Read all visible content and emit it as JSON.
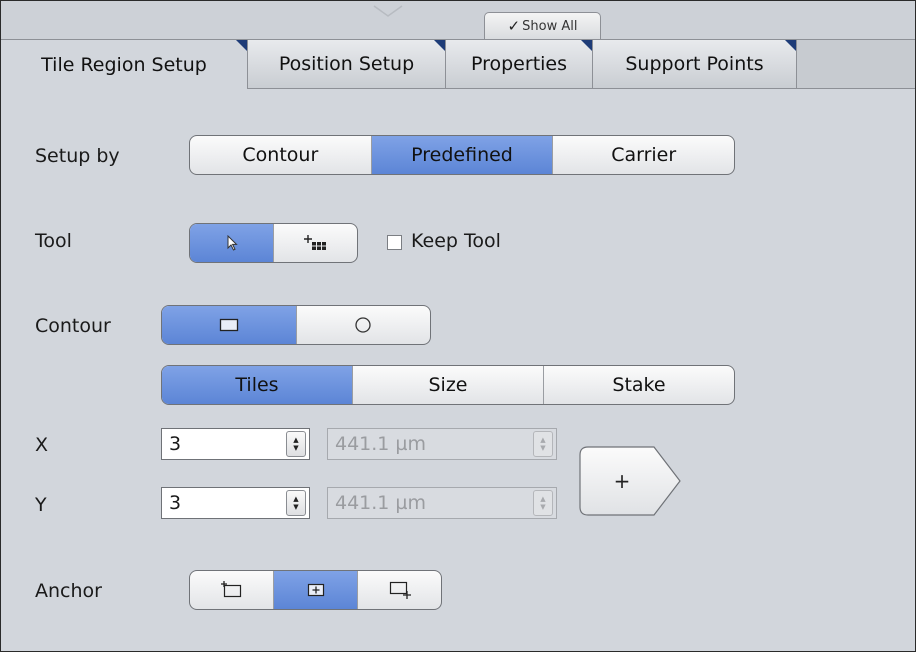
{
  "toolbar": {
    "show_all_check": "✓",
    "show_all_label": "Show All"
  },
  "tabs": [
    {
      "label": "Tile Region Setup",
      "active": true
    },
    {
      "label": "Position Setup",
      "active": false
    },
    {
      "label": "Properties",
      "active": false
    },
    {
      "label": "Support Points",
      "active": false
    }
  ],
  "setup_by": {
    "label": "Setup by",
    "options": [
      "Contour",
      "Predefined",
      "Carrier"
    ],
    "selected": "Predefined"
  },
  "tool": {
    "label": "Tool",
    "options": [
      "pointer-icon",
      "add-tiles-icon"
    ],
    "selected": "pointer-icon",
    "keep_tool_label": "Keep Tool",
    "keep_tool_checked": false
  },
  "contour": {
    "label": "Contour",
    "shapes": [
      "rectangle-icon",
      "circle-icon"
    ],
    "selected_shape": "rectangle-icon",
    "modes": [
      "Tiles",
      "Size",
      "Stake"
    ],
    "selected_mode": "Tiles"
  },
  "x": {
    "label": "X",
    "tiles": "3",
    "size": "441.1 µm"
  },
  "y": {
    "label": "Y",
    "tiles": "3",
    "size": "441.1 µm"
  },
  "add_button": {
    "label": "+"
  },
  "anchor": {
    "label": "Anchor",
    "options": [
      "anchor-top-left-icon",
      "anchor-center-icon",
      "anchor-bottom-right-icon"
    ],
    "selected": "anchor-center-icon"
  },
  "colors": {
    "selected": "#6b90dc",
    "background": "#d2d6dc",
    "tab_corner": "#1e3c78"
  }
}
